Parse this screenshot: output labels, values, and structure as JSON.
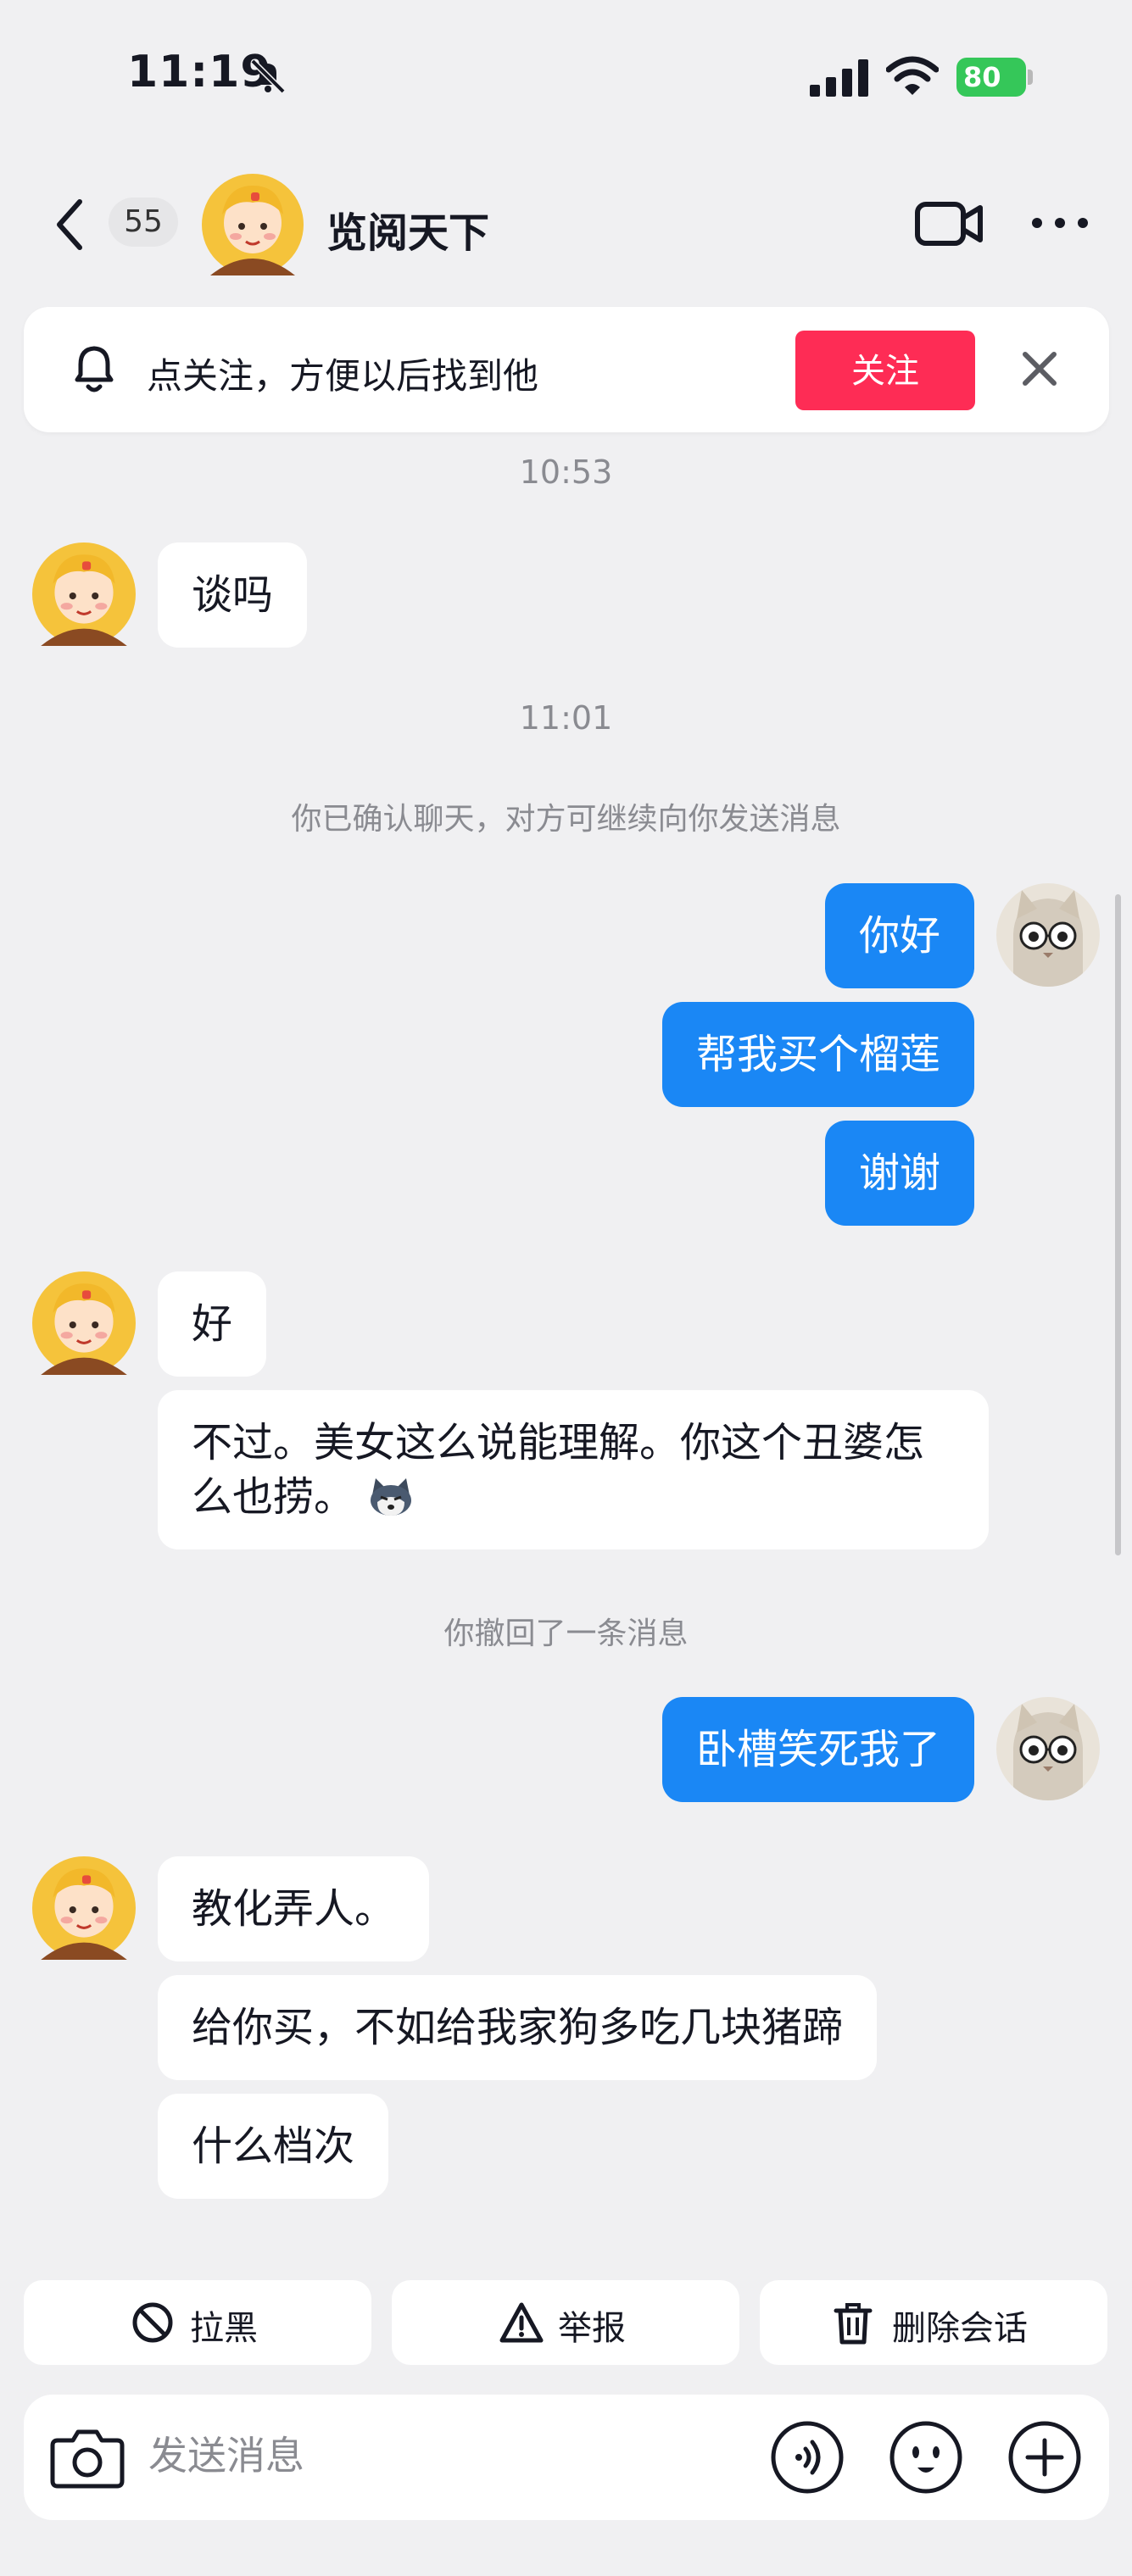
{
  "status_bar": {
    "time": "11:19",
    "battery": "80"
  },
  "header": {
    "unread_count": "55",
    "contact_name": "览阅天下"
  },
  "follow_banner": {
    "text": "点关注，方便以后找到他",
    "button": "关注"
  },
  "chat": {
    "time_1": "10:53",
    "msg_1": "谈吗",
    "time_2": "11:01",
    "system_1": "你已确认聊天，对方可继续向你发送消息",
    "out_1": "你好",
    "out_2": "帮我买个榴莲",
    "out_3": "谢谢",
    "in_2": "好",
    "in_3": "不过。美女这么说能理解。你这个丑婆怎么也捞。",
    "system_2": "你撤回了一条消息",
    "out_4": "卧槽笑死我了",
    "in_4": "教化弄人。",
    "in_5": "给你买，不如给我家狗多吃几块猪蹄",
    "in_6": "什么档次"
  },
  "actions": {
    "block": "拉黑",
    "report": "举报",
    "delete": "删除会话"
  },
  "input": {
    "placeholder": "发送消息"
  },
  "colors": {
    "accent": "#1a87f5",
    "follow": "#fe2c55",
    "battery": "#35c759"
  }
}
